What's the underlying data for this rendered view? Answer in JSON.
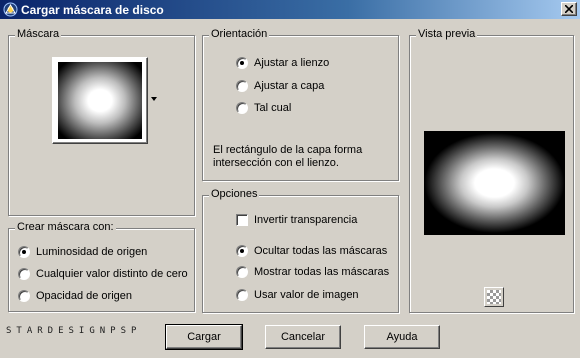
{
  "window": {
    "title": "Cargar máscara de disco",
    "icons": {
      "app": "psp-app-icon",
      "close": "close-icon"
    }
  },
  "mascara": {
    "legend": "Máscara",
    "icons": {
      "dropdown": "chevron-down-icon"
    }
  },
  "crear": {
    "legend": "Crear máscara con:",
    "options": [
      {
        "label": "Luminosidad de origen",
        "checked": true
      },
      {
        "label": "Cualquier valor distinto de cero",
        "checked": false
      },
      {
        "label": "Opacidad de origen",
        "checked": false
      }
    ]
  },
  "orientacion": {
    "legend": "Orientación",
    "options": [
      {
        "label": "Ajustar a lienzo",
        "checked": true
      },
      {
        "label": "Ajustar a capa",
        "checked": false
      },
      {
        "label": "Tal cual",
        "checked": false
      }
    ],
    "note": "El rectángulo de la capa forma intersección con el lienzo."
  },
  "opciones": {
    "legend": "Opciones",
    "invert_label": "Invertir transparencia",
    "invert_checked": false,
    "options": [
      {
        "label": "Ocultar todas las máscaras",
        "checked": true
      },
      {
        "label": "Mostrar todas las máscaras",
        "checked": false
      },
      {
        "label": "Usar valor de imagen",
        "checked": false
      }
    ]
  },
  "vista": {
    "legend": "Vista previa",
    "icons": {
      "transparency": "checkerboard-icon"
    }
  },
  "footer": {
    "brand": "STARDESIGNPSP",
    "ok_label": "Cargar",
    "cancel_label": "Cancelar",
    "help_label": "Ayuda"
  }
}
